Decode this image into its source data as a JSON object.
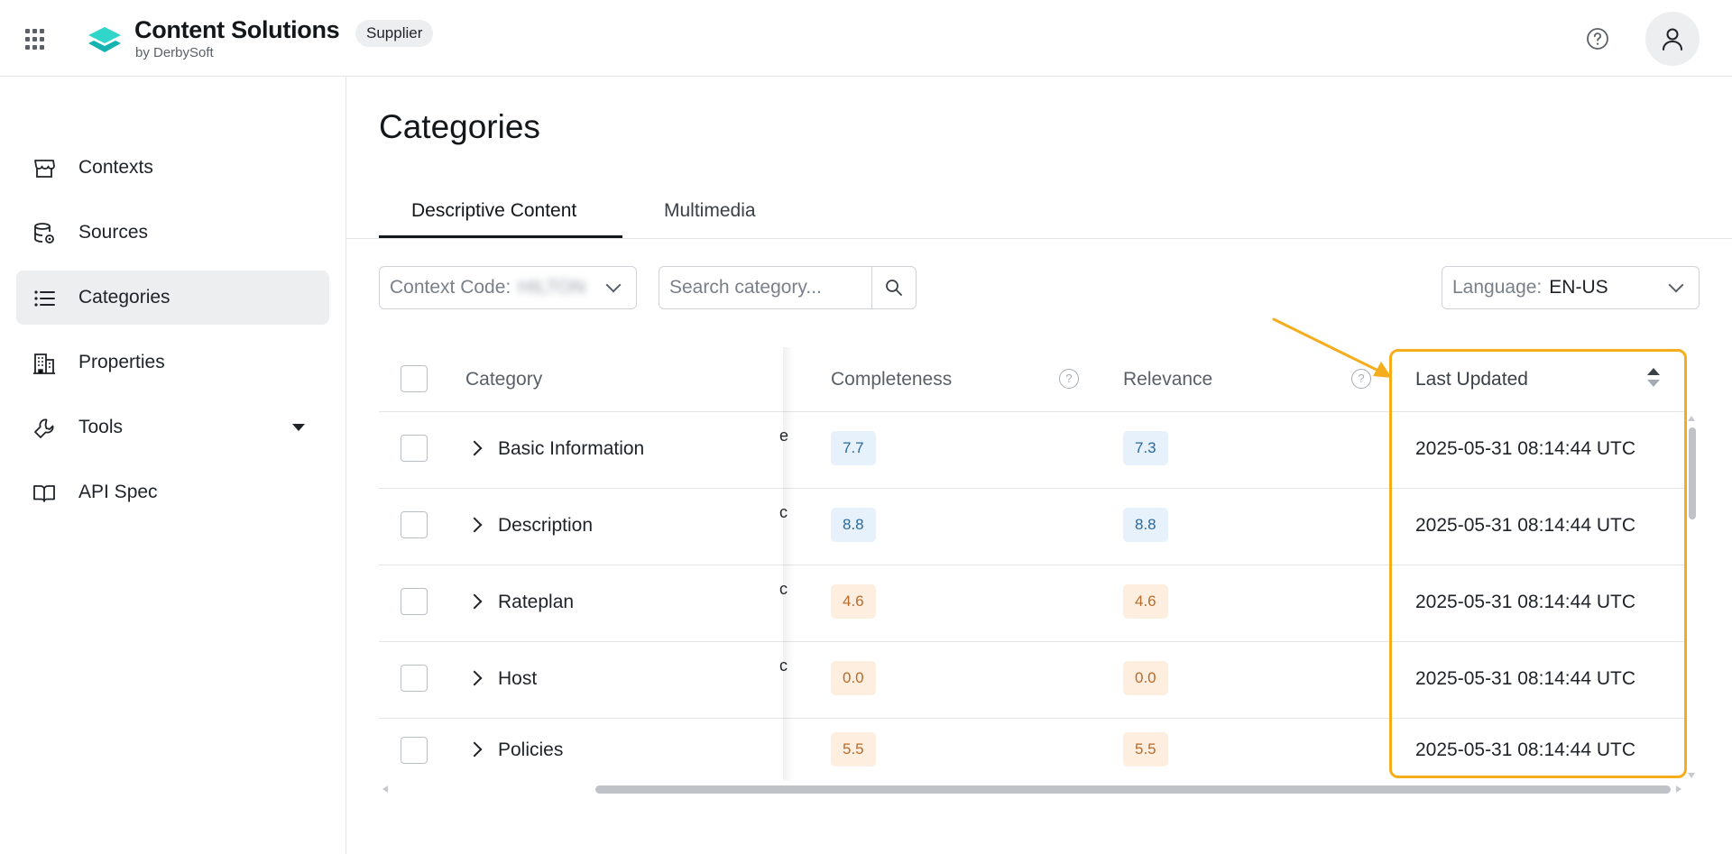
{
  "header": {
    "brand_title": "Content Solutions",
    "brand_subtitle": "by DerbySoft",
    "role_badge": "Supplier",
    "icons": [
      "apps-grid-icon",
      "logo-icon",
      "help-icon",
      "user-icon"
    ]
  },
  "sidebar": {
    "items": [
      {
        "label": "Contexts",
        "icon": "store-icon",
        "active": false
      },
      {
        "label": "Sources",
        "icon": "database-icon",
        "active": false
      },
      {
        "label": "Categories",
        "icon": "list-icon",
        "active": true
      },
      {
        "label": "Properties",
        "icon": "building-icon",
        "active": false
      },
      {
        "label": "Tools",
        "icon": "wrench-icon",
        "active": false,
        "has_dropdown": true
      },
      {
        "label": "API Spec",
        "icon": "book-icon",
        "active": false
      }
    ]
  },
  "main": {
    "page_title": "Categories",
    "tabs": [
      {
        "label": "Descriptive Content",
        "active": true
      },
      {
        "label": "Multimedia",
        "active": false
      }
    ],
    "filters": {
      "context_prefix": "Context Code:",
      "context_value": "HILTON",
      "search_placeholder": "Search category...",
      "language_prefix": "Language:",
      "language_value": "EN-US"
    },
    "table": {
      "columns": {
        "category": "Category",
        "completeness": "Completeness",
        "relevance": "Relevance",
        "last_updated": "Last Updated"
      },
      "rows": [
        {
          "category": "Basic Information",
          "clip": "e",
          "completeness": "7.7",
          "relevance": "7.3",
          "last_updated": "2025-05-31 08:14:44 UTC",
          "color": "blue"
        },
        {
          "category": "Description",
          "clip": "c",
          "completeness": "8.8",
          "relevance": "8.8",
          "last_updated": "2025-05-31 08:14:44 UTC",
          "color": "blue"
        },
        {
          "category": "Rateplan",
          "clip": "c",
          "completeness": "4.6",
          "relevance": "4.6",
          "last_updated": "2025-05-31 08:14:44 UTC",
          "color": "orange"
        },
        {
          "category": "Host",
          "clip": "c",
          "completeness": "0.0",
          "relevance": "0.0",
          "last_updated": "2025-05-31 08:14:44 UTC",
          "color": "orange"
        },
        {
          "category": "Policies",
          "clip": "",
          "completeness": "5.5",
          "relevance": "5.5",
          "last_updated": "2025-05-31 08:14:44 UTC",
          "color": "orange"
        }
      ]
    }
  },
  "colors": {
    "accent_highlight": "#f5ad1b",
    "score_blue_bg": "#e6f1fb",
    "score_orange_bg": "#fdeee0",
    "brand_teal": "#1ec8c0"
  }
}
